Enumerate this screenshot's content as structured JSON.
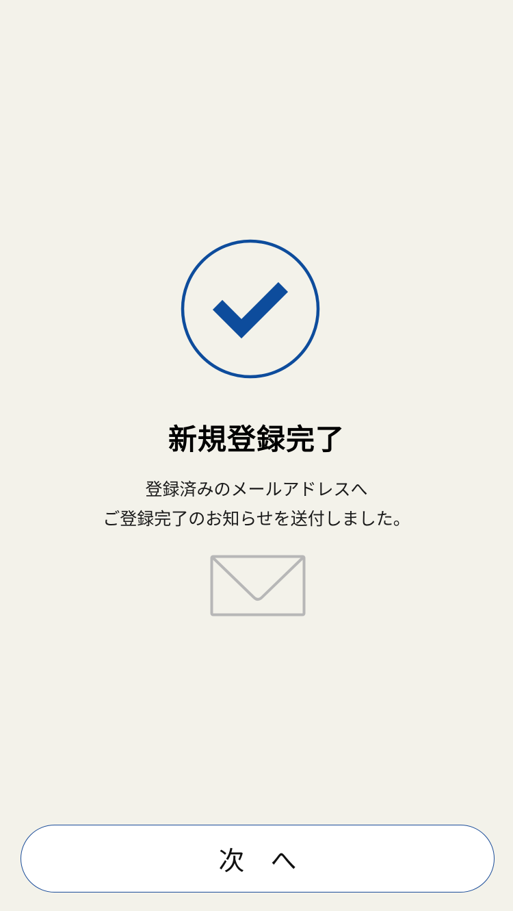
{
  "colors": {
    "background": "#f3f2ea",
    "accent": "#0d4c9c",
    "mail_icon": "#b7b7b7",
    "button_border": "#1a4c99"
  },
  "status": {
    "icon": "check-circle-icon",
    "title": "新規登録完了"
  },
  "message": {
    "line1": "登録済みのメールアドレスへ",
    "line2": "ご登録完了のお知らせを送付しました。",
    "icon": "mail-envelope-icon"
  },
  "actions": {
    "next_label": "次へ"
  }
}
